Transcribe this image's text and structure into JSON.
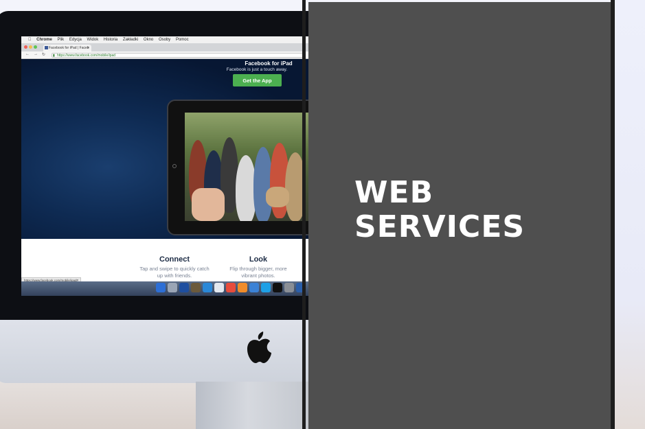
{
  "menubar": {
    "app_name": "Chrome",
    "items": [
      "Plik",
      "Edycja",
      "Widok",
      "Historia",
      "Zakładki",
      "Okno",
      "Osoby",
      "Pomoc"
    ]
  },
  "browser": {
    "tab_title": "Facebook for iPad | Faceb",
    "url": "https://www.facebook.com/mobile/ipad",
    "status_url": "https://www.facebook.com/mobile/ipad#"
  },
  "facebook_page": {
    "hero_title": "Facebook for iPad",
    "hero_subtitle": "Facebook is just a touch away.",
    "cta_label": "Get the App",
    "features": [
      {
        "title": "Connect",
        "description": "Tap and swipe to quickly catch up with friends."
      },
      {
        "title": "Look",
        "description": "Flip through bigger, more vibrant photos."
      }
    ]
  },
  "overlay": {
    "headline_line1": "WEB",
    "headline_line2": "SERVICES",
    "panel_color": "#4f4f4f"
  }
}
